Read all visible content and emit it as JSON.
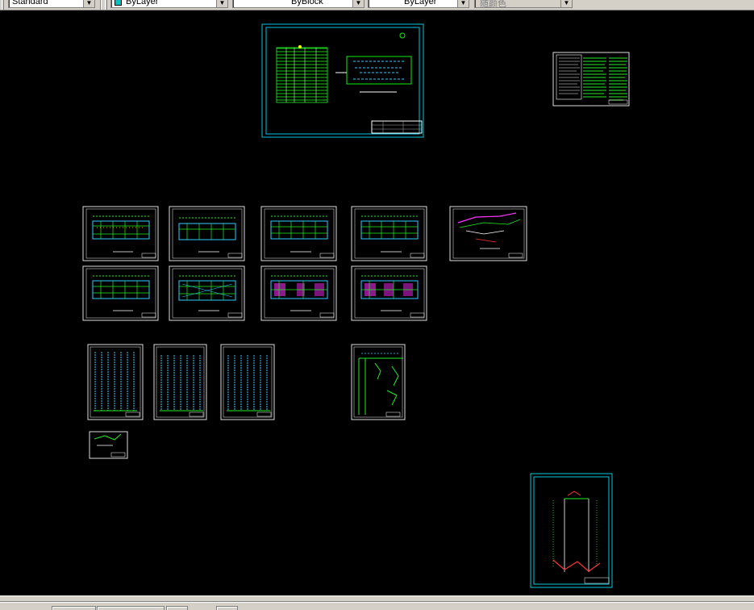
{
  "toolbar": {
    "text_style": {
      "value": "Standard"
    },
    "color": {
      "value": "ByLayer"
    },
    "linetype": {
      "value": "ByBlock"
    },
    "lineweight": {
      "value": "ByLayer"
    },
    "plot_style": {
      "value": "随颜色"
    }
  },
  "icons": {
    "dropdown": "chevron-down-icon",
    "swatch": "color-swatch-icon"
  },
  "colors": {
    "canvas": "#000000",
    "frame": "#ffffff",
    "cyan_frame": "#00c8dc",
    "toolbar": "#d4d0c8",
    "green_lines": "#00ff00",
    "magenta_lines": "#ff00ff",
    "red_lines": "#ff3030"
  },
  "drawing": {
    "sheets": [
      "equipment-layout-sheet",
      "design-notes-sheet",
      "floor-plan-1",
      "floor-plan-2",
      "floor-plan-3",
      "floor-plan-4",
      "isometric-detail-sheet",
      "floor-plan-5",
      "floor-plan-6",
      "floor-plan-7",
      "floor-plan-8",
      "riser-diagram-1",
      "riser-diagram-2",
      "riser-diagram-3",
      "system-diagram-sheet",
      "small-detail-sheet",
      "elevation-riser-sheet"
    ]
  }
}
